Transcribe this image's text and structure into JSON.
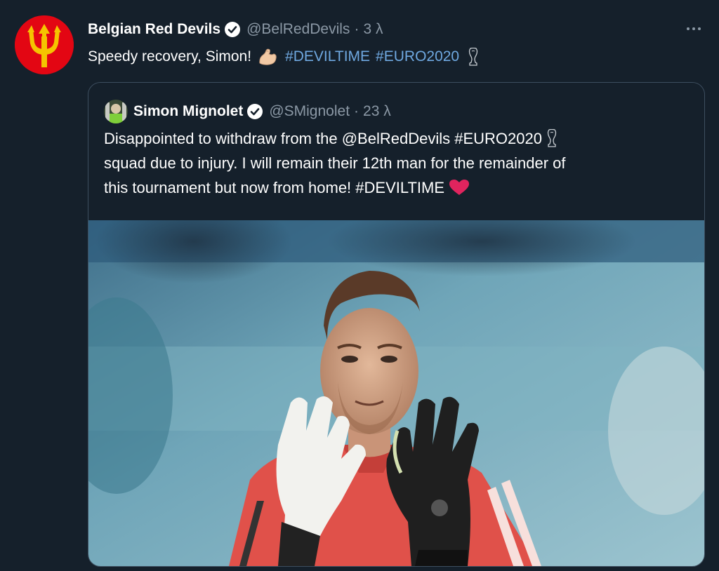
{
  "tweet": {
    "author_name": "Belgian Red Devils",
    "handle": "@BelRedDevils",
    "separator": "·",
    "time": "3 λ",
    "text_part1": "Speedy recovery, Simon!",
    "emoji": "flexed-biceps-icon",
    "hashtag1": "#DEVILTIME",
    "hashtag2": "#EURO2020",
    "trophy": "trophy-icon"
  },
  "quoted": {
    "author_name": "Simon Mignolet",
    "handle": "@SMignolet",
    "separator": "·",
    "time": "23 λ",
    "line1": "Disappointed to withdraw from the @BelRedDevils #EURO2020",
    "line2": "squad due to injury. I will remain their 12th man for the remainder of",
    "line3": "this tournament but now from home! #DEVILTIME",
    "heart": "red-heart-icon",
    "media_alt": "goalkeeper-clapping-photo"
  },
  "colors": {
    "background": "#15202b",
    "brand_red": "#e30613",
    "brand_gold": "#f5c400",
    "link": "#6fa8e0",
    "muted": "#8b98a5",
    "heart": "#e0245e"
  }
}
